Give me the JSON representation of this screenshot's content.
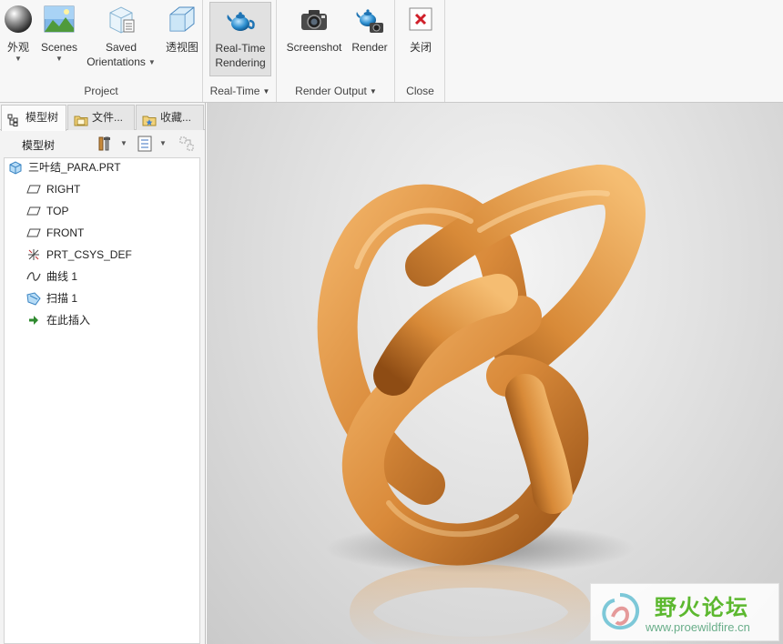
{
  "ribbon": {
    "groups": [
      {
        "label": "Project",
        "has_menu": false
      },
      {
        "label": "Real-Time",
        "has_menu": true
      },
      {
        "label": "Render Output",
        "has_menu": true
      },
      {
        "label": "Close",
        "has_menu": false
      }
    ],
    "buttons": {
      "appearance": {
        "label": "外观",
        "icon": "sphere-icon"
      },
      "scenes": {
        "label": "Scenes",
        "icon": "scene-landscape-icon"
      },
      "saved_orientations": {
        "label_line1": "Saved",
        "label_line2": "Orientations",
        "icon": "saved-orientation-icon"
      },
      "perspective": {
        "label": "透视图",
        "icon": "perspective-cube-icon"
      },
      "realtime_rendering": {
        "label_line1": "Real-Time",
        "label_line2": "Rendering",
        "icon": "teapot-icon",
        "active": true
      },
      "screenshot": {
        "label": "Screenshot",
        "icon": "camera-icon"
      },
      "render": {
        "label": "Render",
        "icon": "teapot-camera-icon"
      },
      "close": {
        "label": "关闭",
        "icon": "close-x-icon"
      }
    }
  },
  "left_panel": {
    "tabs": [
      {
        "label": "模型树",
        "icon": "model-tree-icon",
        "active": true
      },
      {
        "label": "文件...",
        "icon": "folder-icon",
        "active": false
      },
      {
        "label": "收藏...",
        "icon": "favorites-icon",
        "active": false
      }
    ],
    "tree_title": "模型树",
    "tree_items": [
      {
        "label": "三叶结_PARA.PRT",
        "icon": "part-cube-icon",
        "level": 0
      },
      {
        "label": "RIGHT",
        "icon": "datum-plane-icon",
        "level": 1
      },
      {
        "label": "TOP",
        "icon": "datum-plane-icon",
        "level": 1
      },
      {
        "label": "FRONT",
        "icon": "datum-plane-icon",
        "level": 1
      },
      {
        "label": "PRT_CSYS_DEF",
        "icon": "coordinate-system-icon",
        "level": 1
      },
      {
        "label": "曲线 1",
        "icon": "curve-icon",
        "level": 1
      },
      {
        "label": "扫描 1",
        "icon": "sweep-icon",
        "level": 1
      },
      {
        "label": "在此插入",
        "icon": "insert-here-arrow-icon",
        "level": 1
      }
    ]
  },
  "watermark": {
    "title": "野火论坛",
    "url": "www.proewildfire.cn"
  },
  "colors": {
    "wood": "#d98a3a",
    "wood_dark": "#9a5418",
    "accent_blue": "#3a8fd0",
    "close_red": "#d0202a"
  }
}
